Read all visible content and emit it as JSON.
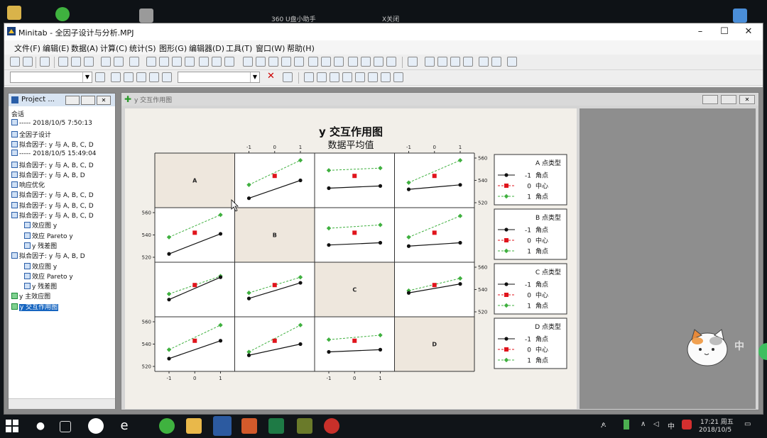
{
  "desktop": {
    "items": [
      {
        "label": "360 U盘小助手"
      },
      {
        "label": "X关闭"
      }
    ]
  },
  "window": {
    "title": "Minitab - 全因子设计与分析.MPJ",
    "controls": {
      "minimize": "–",
      "maximize": "☐",
      "close": "✕"
    }
  },
  "menu": [
    "文件(F)",
    "编辑(E)",
    "数据(A)",
    "计算(C)",
    "统计(S)",
    "图形(G)",
    "编辑器(D)",
    "工具(T)",
    "窗口(W)",
    "帮助(H)"
  ],
  "project": {
    "title": "Project ...",
    "items": [
      {
        "text": "会话",
        "icon": "none",
        "indent": false
      },
      {
        "text": "-----   2018/10/5 7:50:13",
        "icon": "doc",
        "indent": false
      },
      {
        "text": "全因子设计",
        "icon": "doc",
        "indent": false
      },
      {
        "text": "拟合因子: y 与 A, B, C, D",
        "icon": "doc",
        "indent": false
      },
      {
        "text": "-----   2018/10/5 15:49:04",
        "icon": "doc",
        "indent": false
      },
      {
        "text": "拟合因子: y 与 A, B, C, D",
        "icon": "doc",
        "indent": false
      },
      {
        "text": "拟合因子: y 与 A, B, D",
        "icon": "doc",
        "indent": false
      },
      {
        "text": "响应优化",
        "icon": "doc",
        "indent": false
      },
      {
        "text": "拟合因子: y 与 A, B, C, D",
        "icon": "doc",
        "indent": false
      },
      {
        "text": "拟合因子: y 与 A, B, C, D",
        "icon": "doc",
        "indent": false
      },
      {
        "text": "拟合因子: y 与 A, B, C, D",
        "icon": "doc",
        "indent": false
      },
      {
        "text": "效应图 y",
        "icon": "graph",
        "indent": true
      },
      {
        "text": "效应 Pareto          y",
        "icon": "graph",
        "indent": true
      },
      {
        "text": "y 残差图",
        "icon": "graph",
        "indent": true
      },
      {
        "text": "拟合因子: y 与 A, B, D",
        "icon": "doc",
        "indent": false
      },
      {
        "text": "效应图 y",
        "icon": "graph",
        "indent": true
      },
      {
        "text": "效应 Pareto          y",
        "icon": "graph",
        "indent": true
      },
      {
        "text": "y 残差图",
        "icon": "graph",
        "indent": true
      },
      {
        "text": "y 主效应图",
        "icon": "green",
        "indent": false
      },
      {
        "text": "y 交互作用图",
        "icon": "green",
        "indent": false,
        "selected": true
      }
    ]
  },
  "graph_window": {
    "title": "y 交互作用图"
  },
  "chart_data": {
    "type": "line",
    "title": "y  交互作用图",
    "subtitle": "数据平均值",
    "factors": [
      "A",
      "B",
      "C",
      "D"
    ],
    "x_ticks": [
      "-1",
      "0",
      "1"
    ],
    "y_ticks": [
      "520",
      "540",
      "560"
    ],
    "ylim": [
      520,
      560
    ],
    "legend_series": [
      {
        "level": "-1",
        "label": "角点",
        "color": "#111111",
        "style": "solid",
        "marker": "circle"
      },
      {
        "level": "0",
        "label": "中心",
        "color": "#e0141c",
        "style": "dashed",
        "marker": "square"
      },
      {
        "level": "1",
        "label": "角点",
        "color": "#3fb03f",
        "style": "dashed",
        "marker": "diamond"
      }
    ],
    "legends": [
      {
        "factor": "A",
        "title": "A  点类型"
      },
      {
        "factor": "B",
        "title": "B  点类型"
      },
      {
        "factor": "C",
        "title": "C  点类型"
      },
      {
        "factor": "D",
        "title": "D  点类型"
      }
    ],
    "panels": [
      {
        "row": 0,
        "col": 1,
        "low": [
          524,
          540
        ],
        "center": 544,
        "high": [
          536,
          558
        ]
      },
      {
        "row": 0,
        "col": 2,
        "low": [
          533,
          535
        ],
        "center": 544,
        "high": [
          549,
          551
        ]
      },
      {
        "row": 0,
        "col": 3,
        "low": [
          532,
          536
        ],
        "center": 544,
        "high": [
          538,
          558
        ]
      },
      {
        "row": 1,
        "col": 0,
        "low": [
          523,
          541
        ],
        "center": 542,
        "high": [
          538,
          558
        ]
      },
      {
        "row": 1,
        "col": 2,
        "low": [
          531,
          533
        ],
        "center": 542,
        "high": [
          546,
          549
        ]
      },
      {
        "row": 1,
        "col": 3,
        "low": [
          530,
          533
        ],
        "center": 542,
        "high": [
          538,
          557
        ]
      },
      {
        "row": 2,
        "col": 0,
        "low": [
          531,
          551
        ],
        "center": 544,
        "high": [
          536,
          552
        ]
      },
      {
        "row": 2,
        "col": 1,
        "low": [
          532,
          546
        ],
        "center": 544,
        "high": [
          537,
          551
        ]
      },
      {
        "row": 2,
        "col": 3,
        "low": [
          537,
          545
        ],
        "center": 544,
        "high": [
          539,
          550
        ]
      },
      {
        "row": 3,
        "col": 0,
        "low": [
          527,
          543
        ],
        "center": 543,
        "high": [
          535,
          557
        ]
      },
      {
        "row": 3,
        "col": 1,
        "low": [
          530,
          540
        ],
        "center": 543,
        "high": [
          533,
          557
        ]
      },
      {
        "row": 3,
        "col": 2,
        "low": [
          533,
          535
        ],
        "center": 543,
        "high": [
          544,
          548
        ]
      }
    ]
  },
  "taskbar": {
    "clock_time": "17:21 周五",
    "clock_date": "2018/10/5",
    "ime": "中",
    "tray_mid": "∧"
  },
  "overlay": {
    "ime_char": "中"
  }
}
